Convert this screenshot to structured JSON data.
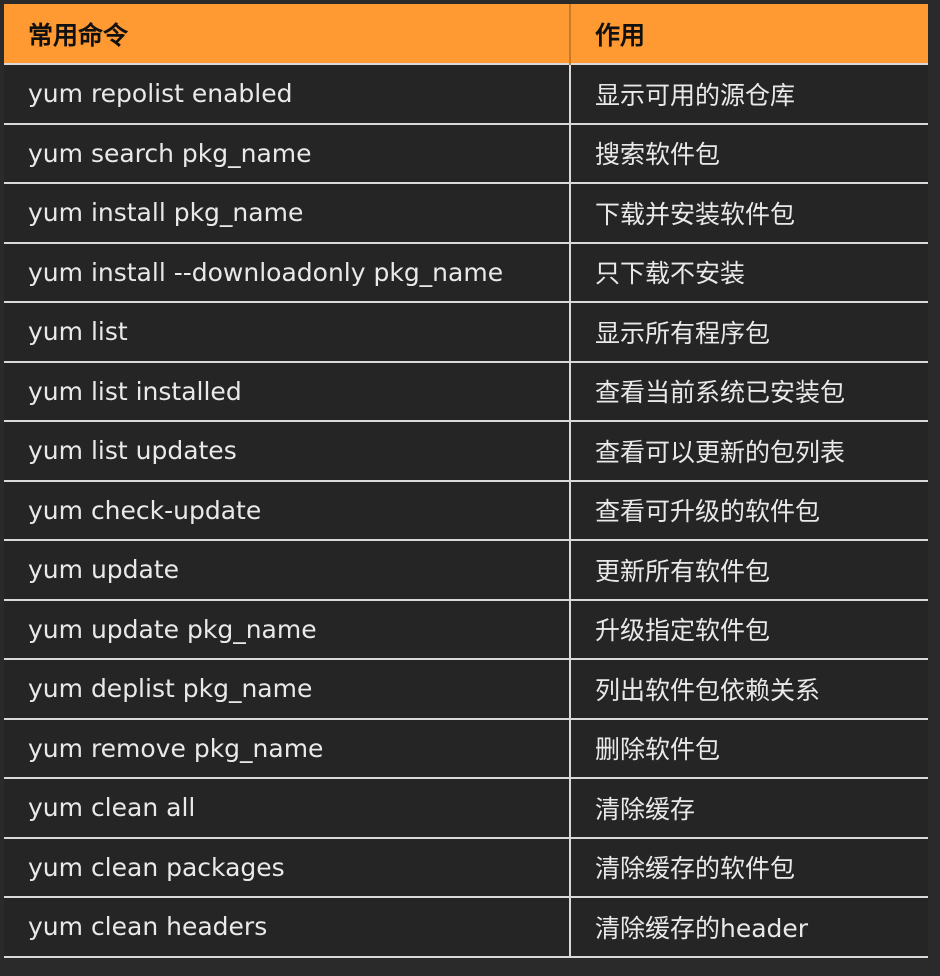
{
  "headers": [
    "常用命令",
    "作用"
  ],
  "rows": [
    [
      "yum repolist enabled",
      "显示可用的源仓库"
    ],
    [
      "yum search pkg_name",
      "搜索软件包"
    ],
    [
      "yum install pkg_name",
      "下载并安装软件包"
    ],
    [
      "yum install --downloadonly pkg_name",
      "只下载不安装"
    ],
    [
      "yum list",
      "显示所有程序包"
    ],
    [
      "yum list installed",
      "查看当前系统已安装包"
    ],
    [
      "yum list updates",
      "查看可以更新的包列表"
    ],
    [
      "yum check-update",
      "查看可升级的软件包"
    ],
    [
      "yum update",
      "更新所有软件包"
    ],
    [
      "yum update pkg_name",
      "升级指定软件包"
    ],
    [
      "yum deplist pkg_name",
      "列出软件包依赖关系"
    ],
    [
      "yum remove pkg_name",
      "删除软件包"
    ],
    [
      "yum clean all",
      "清除缓存"
    ],
    [
      "yum clean packages",
      "清除缓存的软件包"
    ],
    [
      "yum clean headers",
      "清除缓存的header"
    ]
  ],
  "colors": {
    "header_bg": "#ff9a32",
    "body_bg": "#252525",
    "text": "#e9e9e9",
    "grid": "#d9d9d9"
  }
}
